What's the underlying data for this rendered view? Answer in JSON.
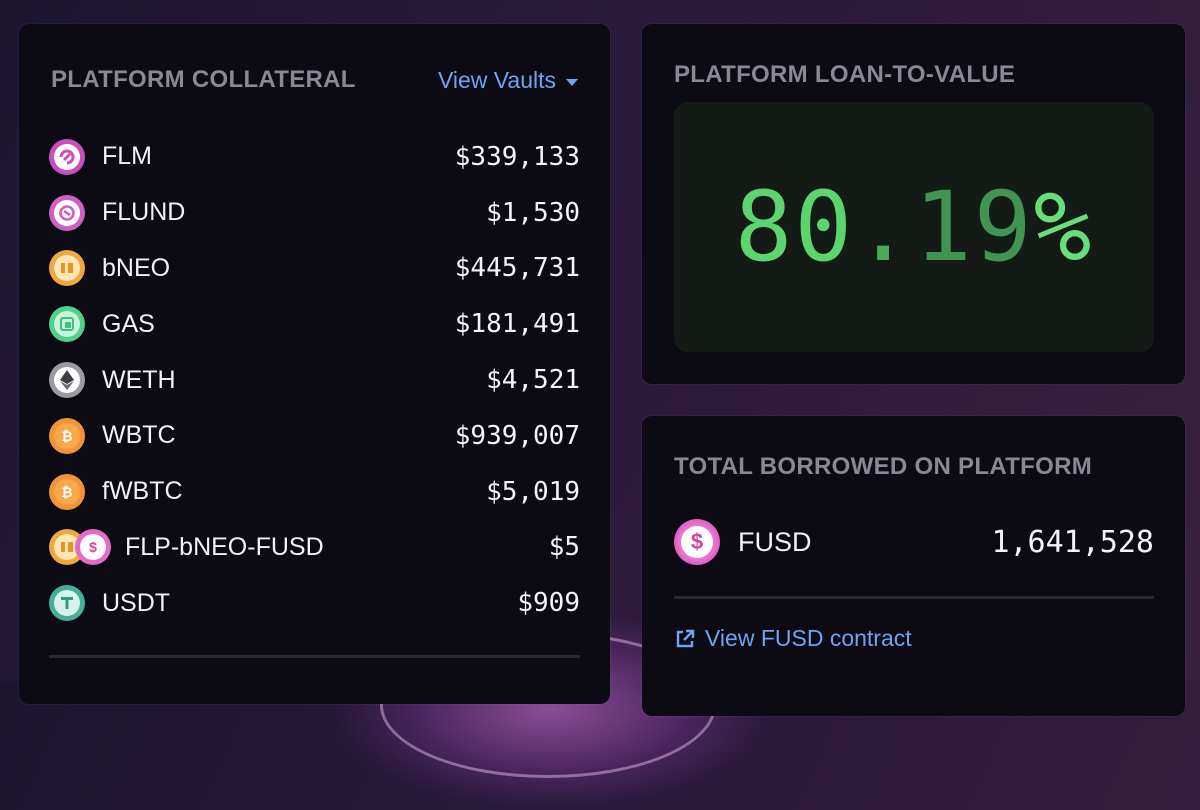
{
  "collateral": {
    "title": "PLATFORM COLLATERAL",
    "view_vaults_label": "View Vaults",
    "assets": [
      {
        "name": "FLM",
        "value": "$339,133",
        "icon": "flm-icon",
        "color": "#c84fbf"
      },
      {
        "name": "FLUND",
        "value": "$1,530",
        "icon": "flund-icon",
        "color": "#d05fc6"
      },
      {
        "name": "bNEO",
        "value": "$445,731",
        "icon": "bneo-icon",
        "color": "#f0a93a"
      },
      {
        "name": "GAS",
        "value": "$181,491",
        "icon": "gas-icon",
        "color": "#4fd08c"
      },
      {
        "name": "WETH",
        "value": "$4,521",
        "icon": "weth-icon",
        "color": "#9a9aa3"
      },
      {
        "name": "WBTC",
        "value": "$939,007",
        "icon": "wbtc-icon",
        "color": "#f09537"
      },
      {
        "name": "fWBTC",
        "value": "$5,019",
        "icon": "fwbtc-icon",
        "color": "#f09537"
      },
      {
        "name": "FLP-bNEO-FUSD",
        "value": "$5",
        "icon": "flp-bneo-fusd-icon",
        "color": "#e66bc9"
      },
      {
        "name": "USDT",
        "value": "$909",
        "icon": "usdt-icon",
        "color": "#45b09a"
      }
    ]
  },
  "ltv": {
    "title": "PLATFORM LOAN-TO-VALUE",
    "value_int": "80",
    "value_dot": ".",
    "value_dec": "19",
    "value_pct": "%"
  },
  "borrowed": {
    "title": "TOTAL BORROWED ON PLATFORM",
    "token": "FUSD",
    "amount": "1,641,528",
    "link_label": "View FUSD contract"
  },
  "colors": {
    "accent_blue": "#6fa3f5",
    "ltv_green": "#5ed46f",
    "card_bg": "#0c0a12"
  }
}
